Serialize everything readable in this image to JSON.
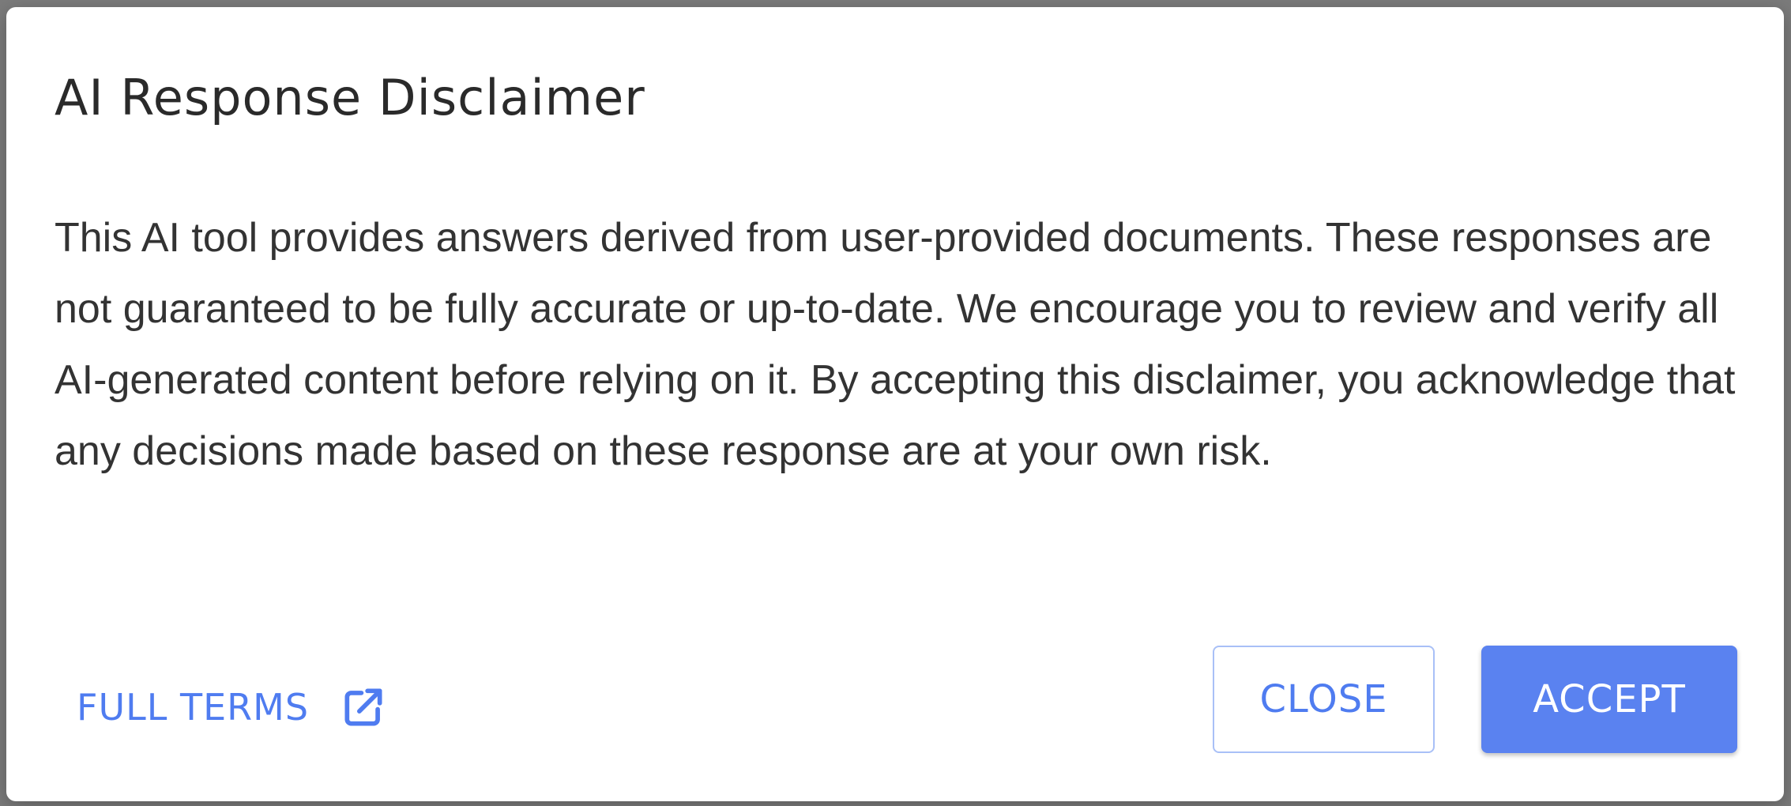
{
  "dialog": {
    "title": "AI Response Disclaimer",
    "body": "This AI tool provides answers derived from user-provided documents. These responses are not guaranteed to be fully accurate or up-to-date. We encourage you to review and verify all AI-generated content before relying on it. By accepting this disclaimer, you acknowledge that any decisions made based on these response are at your own risk.",
    "full_terms_label": "FULL TERMS",
    "full_terms_icon": "external-link-icon",
    "close_label": "CLOSE",
    "accept_label": "ACCEPT"
  },
  "colors": {
    "accent": "#5a82f0",
    "link": "#4f7cf0",
    "backdrop": "#7b7b7b"
  }
}
